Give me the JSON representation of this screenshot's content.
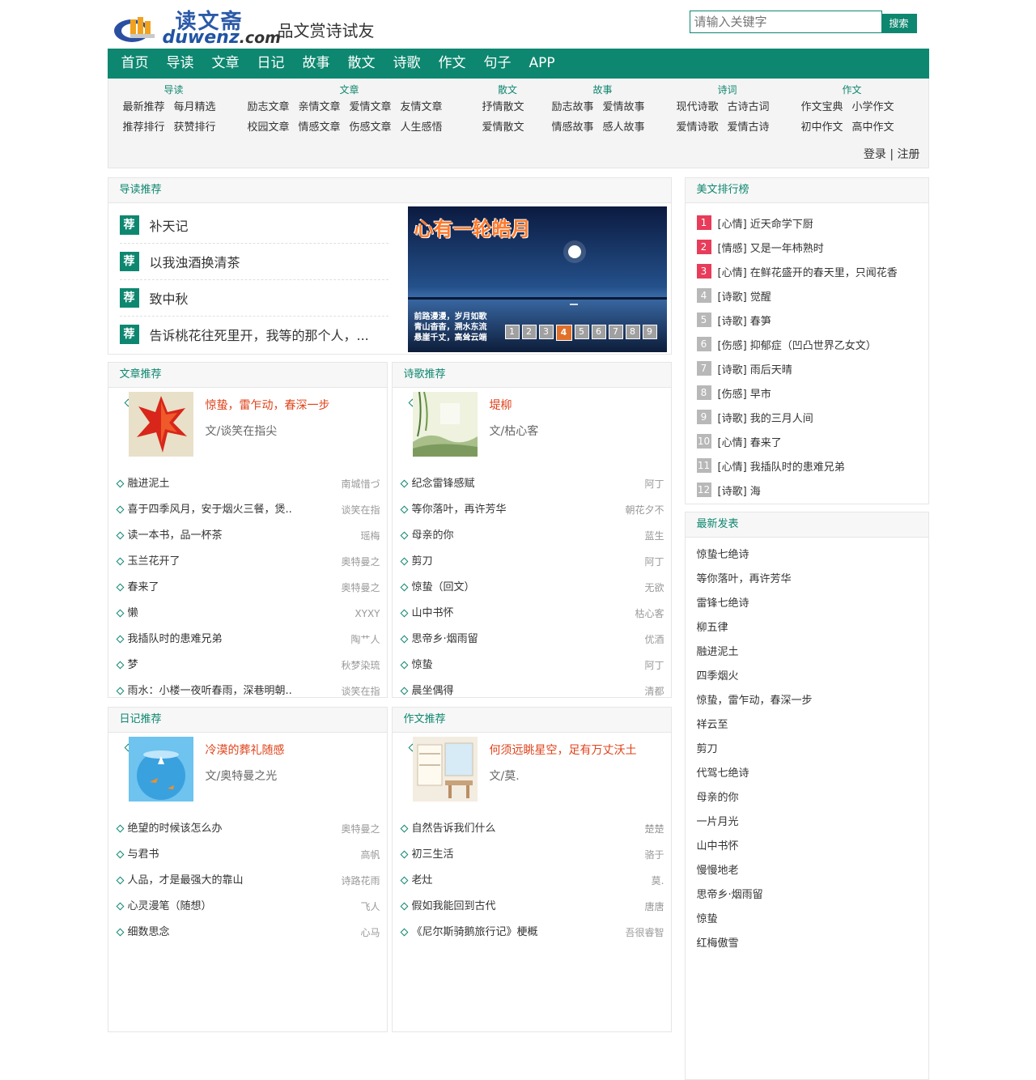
{
  "header": {
    "logo_cn": "读文斋",
    "logo_en": "duwenz",
    "logo_dot": ".com",
    "slogan": "品文赏诗试友",
    "search_placeholder": "请输入关键字",
    "search_button": "搜索"
  },
  "nav": [
    "首页",
    "导读",
    "文章",
    "日记",
    "故事",
    "散文",
    "诗歌",
    "作文",
    "句子",
    "APP"
  ],
  "subnav": {
    "groups": [
      {
        "title": "导读",
        "rows": [
          [
            "最新推荐",
            "每月精选"
          ],
          [
            "推荐排行",
            "获赞排行"
          ]
        ]
      },
      {
        "title": "文章",
        "rows": [
          [
            "励志文章",
            "亲情文章",
            "爱情文章",
            "友情文章"
          ],
          [
            "校园文章",
            "情感文章",
            "伤感文章",
            "人生感悟"
          ]
        ]
      },
      {
        "title": "散文",
        "rows": [
          [
            "抒情散文"
          ],
          [
            "爱情散文"
          ]
        ]
      },
      {
        "title": "故事",
        "rows": [
          [
            "励志故事",
            "爱情故事"
          ],
          [
            "情感故事",
            "感人故事"
          ]
        ]
      },
      {
        "title": "诗词",
        "rows": [
          [
            "现代诗歌",
            "古诗古词"
          ],
          [
            "爱情诗歌",
            "爱情古诗"
          ]
        ]
      },
      {
        "title": "作文",
        "rows": [
          [
            "作文宝典",
            "小学作文"
          ],
          [
            "初中作文",
            "高中作文"
          ]
        ]
      }
    ],
    "login": "登录",
    "sep": "|",
    "register": "注册"
  },
  "daodu": {
    "title": "导读推荐",
    "tag": "荐",
    "items": [
      "补天记",
      "以我浊酒换清茶",
      "致中秋",
      "告诉桃花往死里开，我等的那个人，..."
    ],
    "slide": {
      "title": "心有一轮皓月",
      "poem": [
        "前路漫漫，岁月如歌",
        "青山杳杳，溯水东流",
        "悬崖千丈，高耸云端"
      ],
      "pages": [
        "1",
        "2",
        "3",
        "4",
        "5",
        "6",
        "7",
        "8",
        "9"
      ],
      "active": "4"
    }
  },
  "wenzhang": {
    "title": "文章推荐",
    "feature": {
      "title": "惊蛰，雷乍动，春深一步",
      "author": "文/谈笑在指尖"
    },
    "items": [
      {
        "t": "融进泥土",
        "a": "南城惜づ"
      },
      {
        "t": "喜于四季风月，安于烟火三餐，煲..",
        "a": "谈笑在指"
      },
      {
        "t": "读一本书，品一杯茶",
        "a": "瑶梅"
      },
      {
        "t": "玉兰花开了",
        "a": "奥特曼之"
      },
      {
        "t": "春来了",
        "a": "奥特曼之"
      },
      {
        "t": "懒",
        "a": "XYXY"
      },
      {
        "t": "我插队时的患难兄弟",
        "a": "陶艹人"
      },
      {
        "t": "梦",
        "a": "秋梦染琉"
      },
      {
        "t": "雨水：小楼一夜听春雨，深巷明朝..",
        "a": "谈笑在指"
      }
    ]
  },
  "shige": {
    "title": "诗歌推荐",
    "feature": {
      "title": "堤柳",
      "author": "文/枯心客"
    },
    "items": [
      {
        "t": "纪念雷锋感赋",
        "a": "阿丁"
      },
      {
        "t": "等你落叶，再许芳华",
        "a": "朝花夕不"
      },
      {
        "t": "母亲的你",
        "a": "蓝生"
      },
      {
        "t": "剪刀",
        "a": "阿丁"
      },
      {
        "t": "惊蛰（回文）",
        "a": "无欲"
      },
      {
        "t": "山中书怀",
        "a": "枯心客"
      },
      {
        "t": "思帝乡·烟雨留",
        "a": "优酒"
      },
      {
        "t": "惊蛰",
        "a": "阿丁"
      },
      {
        "t": "晨坐偶得",
        "a": "清都"
      }
    ]
  },
  "riji": {
    "title": "日记推荐",
    "feature": {
      "title": "冷漠的葬礼随感",
      "author": "文/奥特曼之光"
    },
    "items": [
      {
        "t": "绝望的时候该怎么办",
        "a": "奥特曼之"
      },
      {
        "t": "与君书",
        "a": "高帆"
      },
      {
        "t": "人品，才是最强大的靠山",
        "a": "诗路花雨"
      },
      {
        "t": "心灵漫笔（随想）",
        "a": "飞人"
      },
      {
        "t": "细数思念",
        "a": "心马"
      }
    ]
  },
  "zuowen": {
    "title": "作文推荐",
    "feature": {
      "title": "何须远眺星空，足有万丈沃土",
      "author": "文/莫."
    },
    "items": [
      {
        "t": "自然告诉我们什么",
        "a": "楚楚"
      },
      {
        "t": "初三生活",
        "a": "骆于"
      },
      {
        "t": "老灶",
        "a": "莫."
      },
      {
        "t": "假如我能回到古代",
        "a": "唐唐"
      },
      {
        "t": "《尼尔斯骑鹅旅行记》梗概",
        "a": "吾很睿智"
      }
    ]
  },
  "rank": {
    "title": "美文排行榜",
    "items": [
      {
        "n": "1",
        "t": "[心情] 近天命学下厨"
      },
      {
        "n": "2",
        "t": "[情感] 又是一年柿熟时"
      },
      {
        "n": "3",
        "t": "[心情] 在鲜花盛开的春天里，只闻花香"
      },
      {
        "n": "4",
        "t": "[诗歌] 觉醒"
      },
      {
        "n": "5",
        "t": "[诗歌] 春笋"
      },
      {
        "n": "6",
        "t": "[伤感] 抑郁症（凹凸世界乙女文）"
      },
      {
        "n": "7",
        "t": "[诗歌] 雨后天晴"
      },
      {
        "n": "8",
        "t": "[伤感] 早市"
      },
      {
        "n": "9",
        "t": "[诗歌] 我的三月人间"
      },
      {
        "n": "10",
        "t": "[心情] 春来了"
      },
      {
        "n": "11",
        "t": "[心情] 我插队时的患难兄弟"
      },
      {
        "n": "12",
        "t": "[诗歌] 海"
      }
    ]
  },
  "latest": {
    "title": "最新发表",
    "items": [
      "惊蛰七绝诗",
      "等你落叶，再许芳华",
      "雷锋七绝诗",
      "柳五律",
      "融进泥土",
      "四季烟火",
      "惊蛰，雷乍动，春深一步",
      "祥云至",
      "剪刀",
      "代驾七绝诗",
      "母亲的你",
      "一片月光",
      "山中书怀",
      "慢慢地老",
      "思帝乡·烟雨留",
      "惊蛰",
      "红梅傲雪"
    ]
  }
}
